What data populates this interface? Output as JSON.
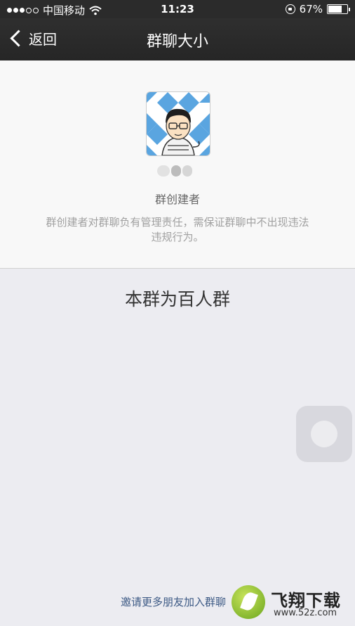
{
  "status_bar": {
    "carrier": "中国移动",
    "time": "11:23",
    "battery": "67%",
    "battery_level": 0.67,
    "signal_icon": "signal-dots-icon",
    "wifi_icon": "wifi-icon",
    "rotation_lock_icon": "rotation-lock-icon"
  },
  "nav": {
    "back_label": "返回",
    "title": "群聊大小"
  },
  "creator": {
    "role": "群创建者",
    "description": "群创建者对群聊负有管理责任，需保证群聊中不出现违法违规行为。"
  },
  "group_size_text": "本群为百人群",
  "invite_link": "邀请更多朋友加入群聊",
  "watermark": {
    "text": "飞翔下载",
    "url": "www.52z.com"
  },
  "colors": {
    "nav_bg": "#2b2b2b",
    "page_bg": "#ececf1",
    "link": "#3d5a85"
  }
}
